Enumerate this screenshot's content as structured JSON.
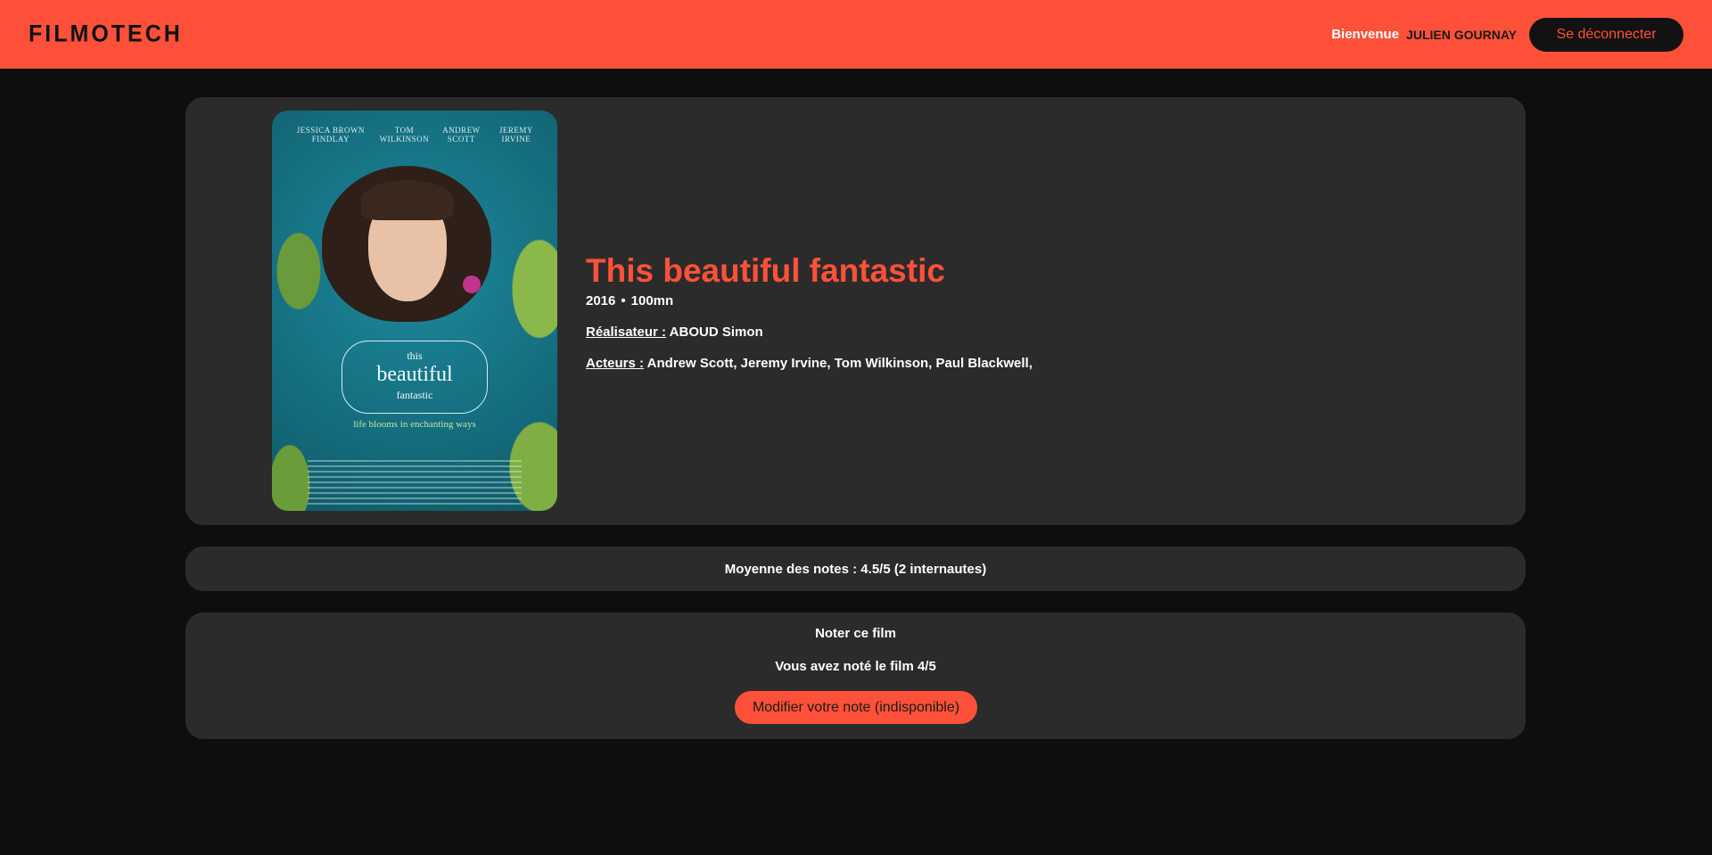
{
  "colors": {
    "accent": "#ff5139",
    "background": "#0e0e0e",
    "card": "#2b2b2b"
  },
  "header": {
    "logo": "FILMOTECH",
    "welcome_label": "Bienvenue",
    "username": "JULIEN GOURNAY",
    "logout_label": "Se déconnecter"
  },
  "film": {
    "poster": {
      "credits": [
        "JESSICA BROWN FINDLAY",
        "TOM WILKINSON",
        "ANDREW SCOTT",
        "JEREMY IRVINE"
      ],
      "title_line1": "this",
      "title_line2": "beautiful",
      "title_line3": "fantastic",
      "tagline": "life blooms in enchanting ways"
    },
    "title": "This beautiful fantastic",
    "year": "2016",
    "separator": "•",
    "duration": "100mn",
    "director_label": "Réalisateur :",
    "director": "ABOUD Simon",
    "actors_label": "Acteurs :",
    "actors": "Andrew Scott, Jeremy Irvine, Tom Wilkinson, Paul Blackwell,"
  },
  "average": {
    "text": "Moyenne des notes : 4.5/5 (2 internautes)"
  },
  "rating": {
    "title": "Noter ce film",
    "status": "Vous avez noté le film 4/5",
    "modify_label": "Modifier votre note (indisponible)"
  }
}
